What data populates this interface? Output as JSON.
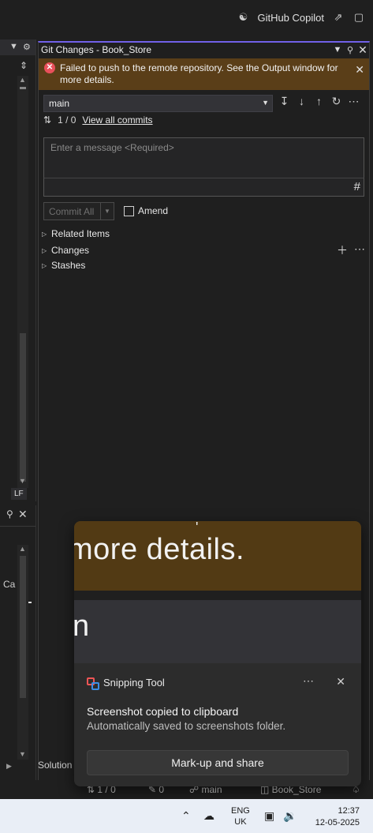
{
  "topbar": {
    "copilot_label": "GitHub Copilot"
  },
  "leftpane": {
    "line_ending": "LF",
    "truncated_label": "Ca"
  },
  "git_changes": {
    "title": "Git Changes - Book_Store",
    "error": "Failed to push to the remote repository. See the Output window for more details.",
    "branch": "main",
    "commits_counter": "1 / 0",
    "view_all_commits": "View all commits",
    "message_placeholder": "Enter a message <Required>",
    "commit_all_label": "Commit All",
    "amend_label": "Amend",
    "tree": {
      "related": "Related Items",
      "changes": "Changes",
      "stashes": "Stashes"
    }
  },
  "toast": {
    "zoom_text_top": "more details.",
    "zoom_text_mid": "n",
    "app_name": "Snipping Tool",
    "title": "Screenshot copied to clipboard",
    "subtitle": "Automatically saved to screenshots folder.",
    "action": "Mark-up and share"
  },
  "solution_tab": "Solution",
  "statusbar": {
    "commits": "1 / 0",
    "pending": "0",
    "branch": "main",
    "repo": "Book_Store"
  },
  "taskbar": {
    "lang_top": "ENG",
    "lang_bottom": "UK",
    "time": "12:37",
    "date": "12-05-2025"
  }
}
